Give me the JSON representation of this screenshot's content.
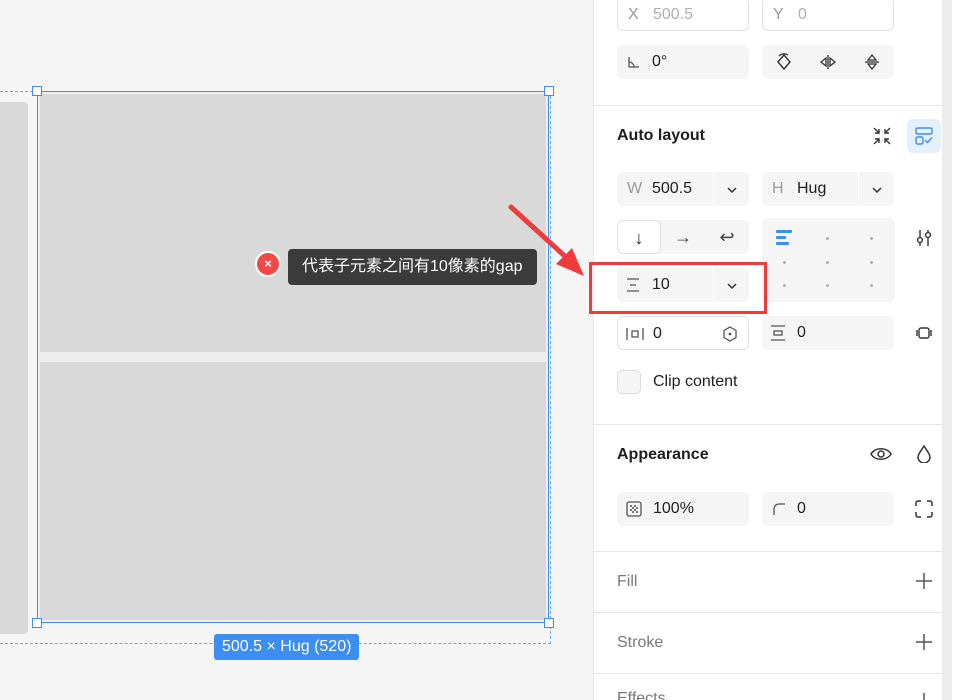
{
  "canvas": {
    "tooltip": "代表子元素之间有10像素的gap",
    "error_glyph": "×",
    "size_label": "500.5 × Hug (520)"
  },
  "position": {
    "x_label": "X",
    "x_value": "500.5",
    "y_label": "Y",
    "y_value": "0",
    "rotation_value": "0°"
  },
  "auto_layout": {
    "title": "Auto layout",
    "width_label": "W",
    "width_value": "500.5",
    "height_label": "H",
    "height_value": "Hug",
    "gap_value": "10",
    "padding_horizontal": "0",
    "padding_vertical": "0",
    "clip_label": "Clip content",
    "clip_checked": false,
    "direction": "vertical"
  },
  "appearance": {
    "title": "Appearance",
    "opacity": "100%",
    "corner_radius": "0"
  },
  "fill": {
    "title": "Fill"
  },
  "stroke": {
    "title": "Stroke"
  },
  "effects": {
    "title": "Effects"
  },
  "colors": {
    "accent": "#3d8ef2",
    "annotation": "#ee3b3b"
  }
}
